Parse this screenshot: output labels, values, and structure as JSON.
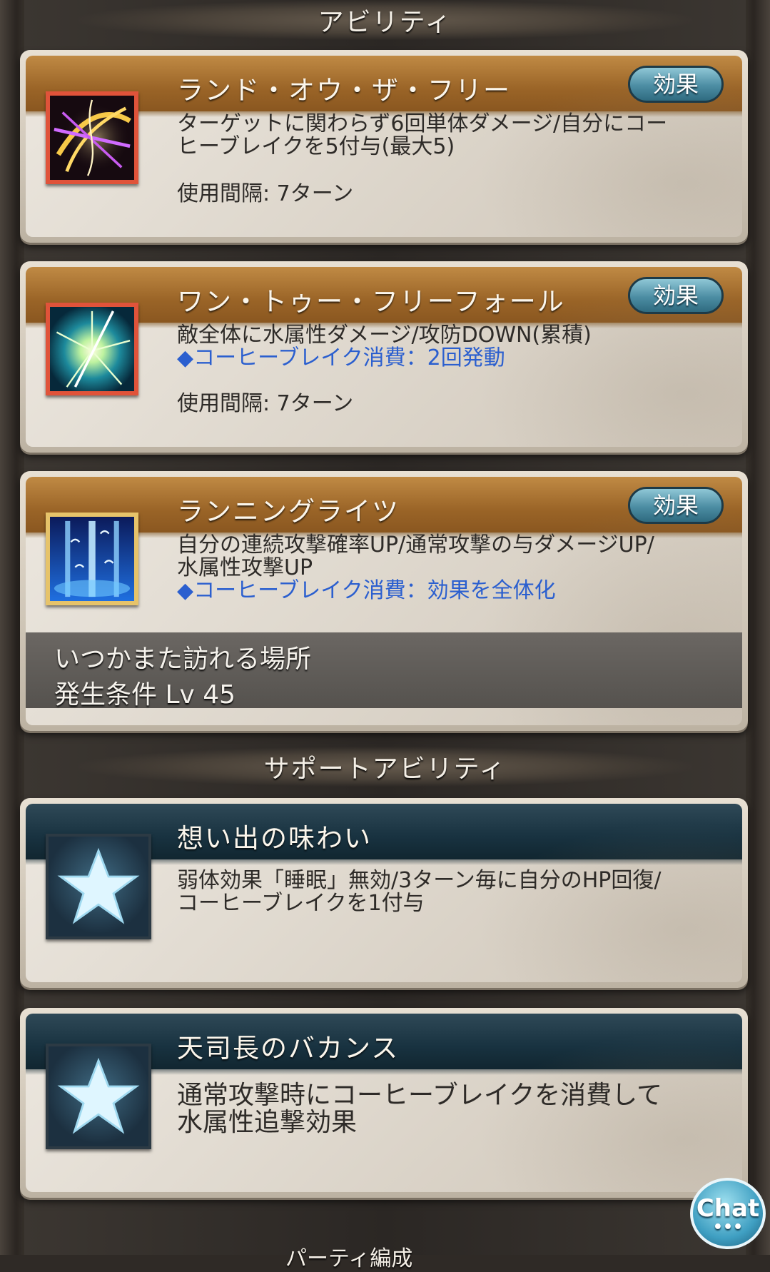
{
  "sections": {
    "ability_title": "アビリティ",
    "support_title": "サポートアビリティ"
  },
  "abilities": [
    {
      "name": "ランド・オウ・ザ・フリー",
      "effect_label": "効果",
      "icon": "golden-crossed-slash-icon",
      "desc_line1": "ターゲットに関わらず6回単体ダメージ/自分にコー",
      "desc_line2": "ヒーブレイクを5付与(最大5)",
      "interval": "使用間隔: 7ターン"
    },
    {
      "name": "ワン・トゥー・フリーフォール",
      "effect_label": "効果",
      "icon": "water-burst-icon",
      "desc_line1": "敵全体に水属性ダメージ/攻防DOWN(累積)",
      "desc_line2": "◆コーヒーブレイク消費：2回発動",
      "interval": "使用間隔: 7ターン"
    },
    {
      "name": "ランニングライツ",
      "effect_label": "効果",
      "icon": "blue-light-pillars-icon",
      "desc_line1": "自分の連続攻撃確率UP/通常攻撃の与ダメージUP/",
      "desc_line2": "水属性攻撃UP",
      "desc_line3": "◆コーヒーブレイク消費：効果を全体化",
      "unlock_name": "いつかまた訪れる場所",
      "unlock_condition": "発生条件 Lv 45"
    }
  ],
  "support_abilities": [
    {
      "name": "想い出の味わい",
      "icon": "star-icon",
      "desc_line1": "弱体効果「睡眠」無効/3ターン毎に自分のHP回復/",
      "desc_line2": "コーヒーブレイクを1付与"
    },
    {
      "name": "天司長のバカンス",
      "icon": "star-icon",
      "desc_line1": "通常攻撃時にコーヒーブレイクを消費して",
      "desc_line2": "水属性追撃効果"
    }
  ],
  "chat": {
    "label": "Chat",
    "dots": "•••"
  },
  "bottom_peek": "パーティ編成"
}
